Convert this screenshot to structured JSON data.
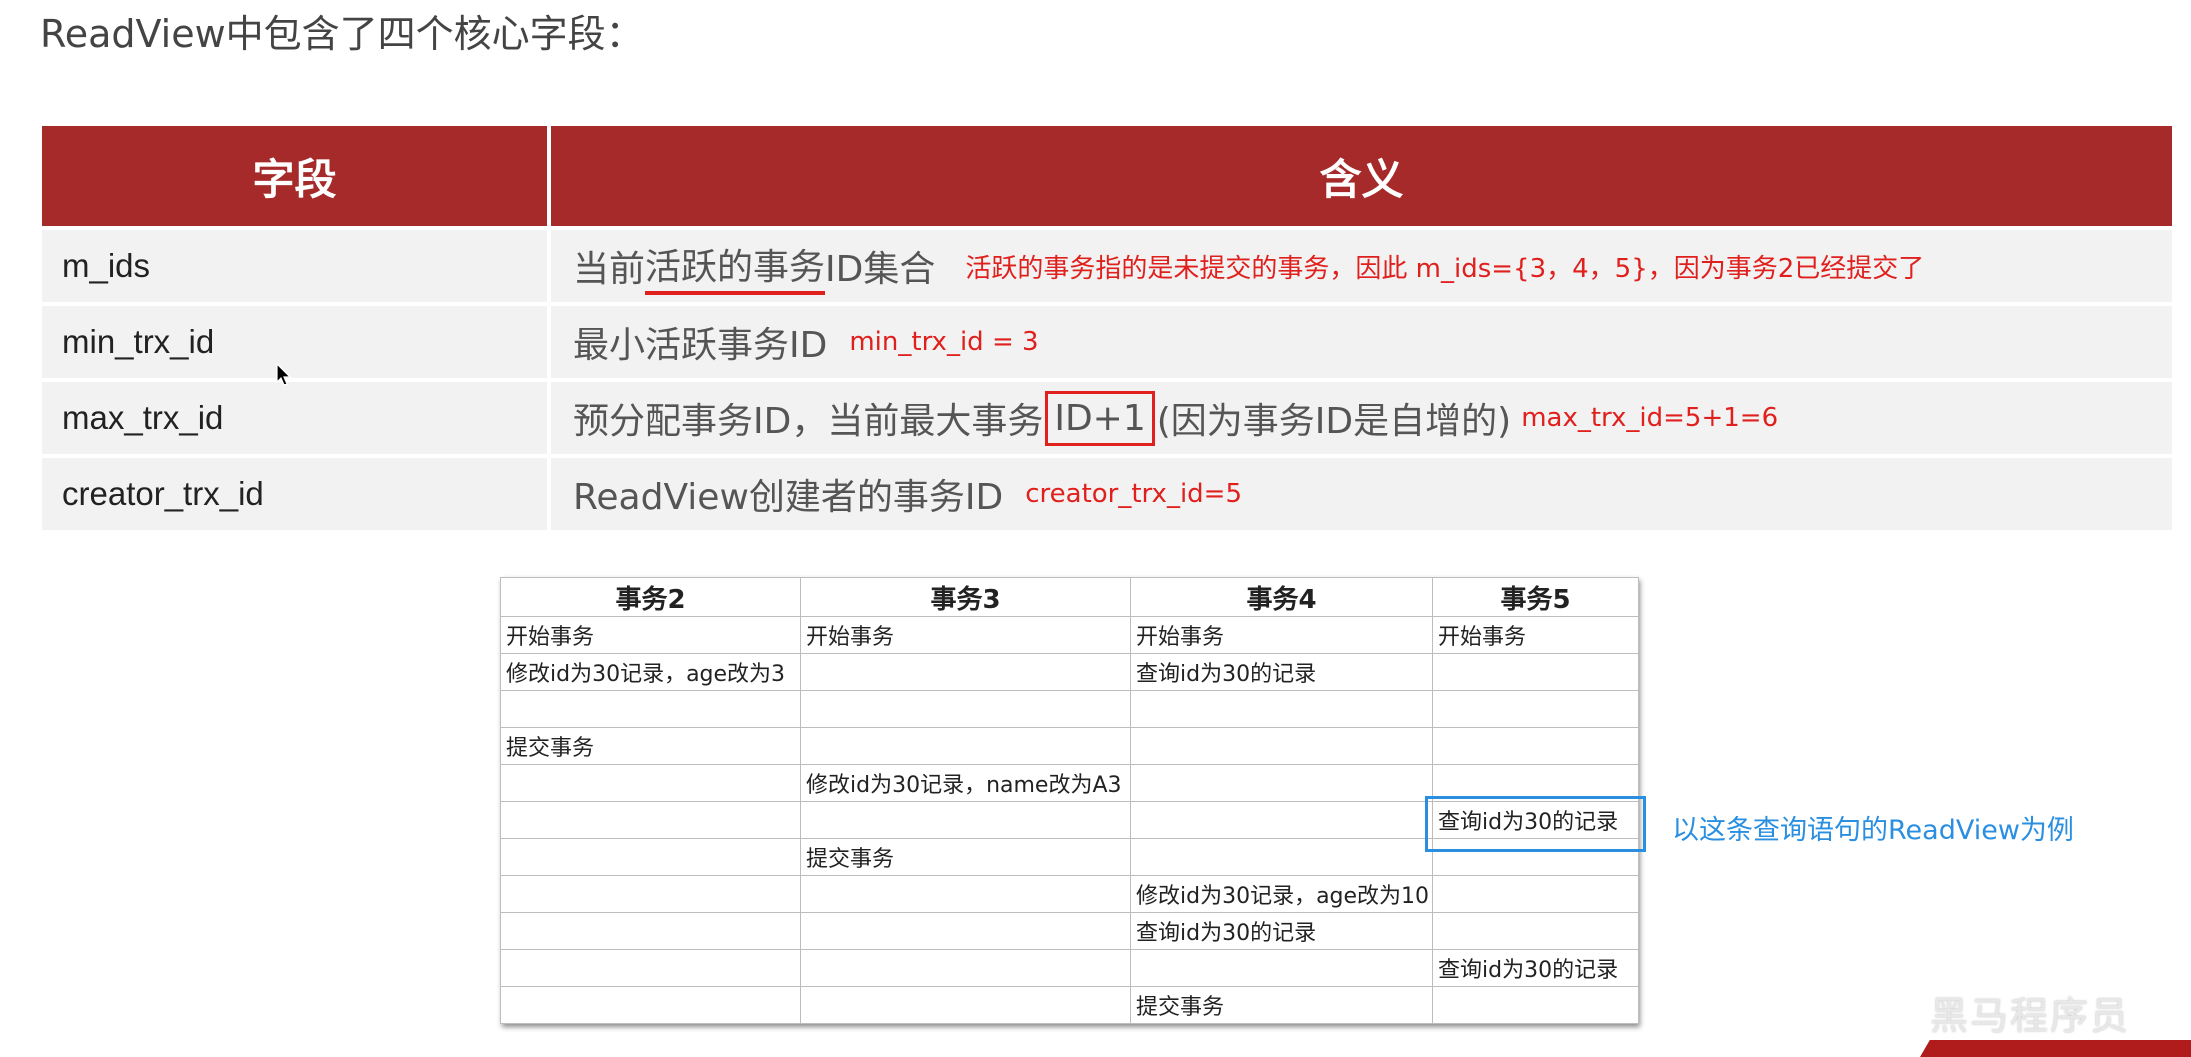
{
  "heading": "ReadView中包含了四个核心字段：",
  "fields_table": {
    "headers": [
      "字段",
      "含义"
    ],
    "rows": [
      {
        "field": "m_ids",
        "meaning_pre": "当前",
        "meaning_underlined": "活跃的事务",
        "meaning_post": "ID集合",
        "note": "活跃的事务指的是未提交的事务，因此 m_ids={3，4，5}，因为事务2已经提交了"
      },
      {
        "field": "min_trx_id",
        "meaning": "最小活跃事务ID",
        "note": "min_trx_id = 3"
      },
      {
        "field": "max_trx_id",
        "meaning_pre": "预分配事务ID，当前最大事务",
        "meaning_boxed": "ID+1",
        "meaning_post": "(因为事务ID是自增的)",
        "note": "max_trx_id=5+1=6"
      },
      {
        "field": "creator_trx_id",
        "meaning": "ReadView创建者的事务ID",
        "note": "creator_trx_id=5"
      }
    ]
  },
  "trx_table": {
    "headers": [
      "事务2",
      "事务3",
      "事务4",
      "事务5"
    ],
    "rows": [
      [
        "开始事务",
        "开始事务",
        "开始事务",
        "开始事务"
      ],
      [
        "修改id为30记录，age改为3",
        "",
        "查询id为30的记录",
        ""
      ],
      [
        "",
        "",
        "",
        ""
      ],
      [
        "提交事务",
        "",
        "",
        ""
      ],
      [
        "",
        "修改id为30记录，name改为A3",
        "",
        ""
      ],
      [
        "",
        "",
        "",
        "查询id为30的记录"
      ],
      [
        "",
        "提交事务",
        "",
        ""
      ],
      [
        "",
        "",
        "修改id为30记录，age改为10",
        ""
      ],
      [
        "",
        "",
        "查询id为30的记录",
        ""
      ],
      [
        "",
        "",
        "",
        "查询id为30的记录"
      ],
      [
        "",
        "",
        "提交事务",
        ""
      ]
    ]
  },
  "highlight_note": "以这条查询语句的ReadView为例",
  "watermark": "黑马程序员",
  "colors": {
    "header_bg": "#a62a2a",
    "note_red": "#e0201d",
    "highlight_blue": "#2a8fe0",
    "row_bg": "#f2f2f2"
  }
}
